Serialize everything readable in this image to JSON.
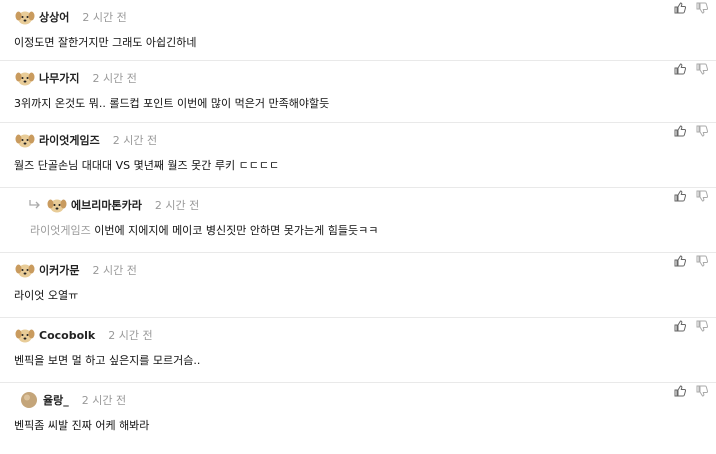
{
  "comments": [
    {
      "nickname": "상상어",
      "time": "2 시간 전",
      "text": "이정도면 잘한거지만 그래도 아쉽긴하네",
      "avatar": "puppy-avatar"
    },
    {
      "nickname": "나무가지",
      "time": "2 시간 전",
      "text": "3위까지 온것도 뭐.. 롤드컵 포인트 이번에 많이 먹은거 만족해야할듯",
      "avatar": "puppy-avatar"
    },
    {
      "nickname": "라이엇게임즈",
      "time": "2 시간 전",
      "text": "월즈 단골손님 대대대 VS 몇년째 월즈 못간 루키 ㄷㄷㄷㄷ",
      "avatar": "puppy-avatar"
    },
    {
      "nickname": "에브리마톤카라",
      "time": "2 시간 전",
      "mention": "라이엇게임즈",
      "text": " 이번에 지에지에 메이코 병신짓만 안하면 못가는게 힘들듯ㅋㅋ",
      "avatar": "puppy-avatar",
      "reply": true
    },
    {
      "nickname": "이커가문",
      "time": "2 시간 전",
      "text": "라이엇 오열ㅠ",
      "avatar": "puppy-avatar"
    },
    {
      "nickname": "Cocobolk",
      "time": "2 시간 전",
      "text": "벤픽을 보면 멀 하고 싶은지를 모르거슴..",
      "avatar": "puppy-avatar"
    },
    {
      "nickname": "율랑_",
      "time": "2 시간 전",
      "text": "벤픽좀 씨발 진짜 어케 해봐라",
      "avatar": "circle-avatar"
    }
  ],
  "icons": {
    "like": "thumbs-up-icon",
    "dislike": "thumbs-down-icon",
    "reply": "reply-arrow-icon"
  },
  "colors": {
    "nickname": "#222222",
    "time": "#999999",
    "mention": "#9a9a9a",
    "divider": "#e9e9e9",
    "avatar_fur": "#e3c48e",
    "avatar_circle": "#c9b08a"
  }
}
